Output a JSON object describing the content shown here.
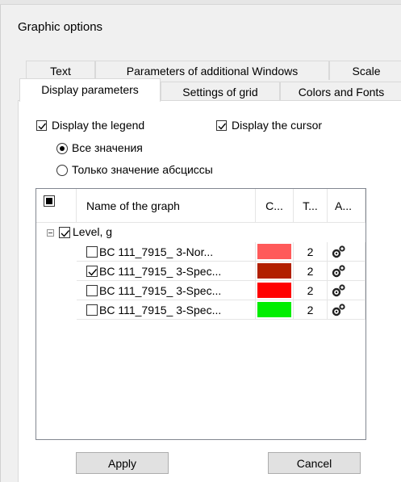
{
  "dialog": {
    "title": "Graphic options"
  },
  "tabs": {
    "text": "Text",
    "additional_windows": "Parameters of additional Windows",
    "scale": "Scale",
    "display_parameters": "Display parameters",
    "grid": "Settings of grid",
    "colors_fonts": "Colors and Fonts",
    "active": "display_parameters"
  },
  "options": {
    "display_legend": {
      "label": "Display the legend",
      "checked": true
    },
    "display_cursor": {
      "label": "Display the cursor",
      "checked": true
    },
    "radio_all": {
      "label": "Все значения",
      "selected": true
    },
    "radio_abscissa": {
      "label": "Только значение абсциссы",
      "selected": false
    }
  },
  "grid": {
    "headers": {
      "name": "Name of the graph",
      "color": "C...",
      "thickness": "T...",
      "action": "A..."
    },
    "group": {
      "label": "Level, g",
      "checked": true,
      "expanded": true
    },
    "rows": [
      {
        "name": "BC 111_7915_ 3-Nor...",
        "checked": false,
        "color": "#ff5a5a",
        "thickness": "2",
        "action_icon": "gears-icon"
      },
      {
        "name": "BC 111_7915_ 3-Spec...",
        "checked": true,
        "color": "#b22000",
        "thickness": "2",
        "action_icon": "gears-icon"
      },
      {
        "name": "BC 111_7915_ 3-Spec...",
        "checked": false,
        "color": "#ff0000",
        "thickness": "2",
        "action_icon": "gears-icon"
      },
      {
        "name": "BC 111_7915_ 3-Spec...",
        "checked": false,
        "color": "#00ee00",
        "thickness": "2",
        "action_icon": "gears-icon"
      }
    ]
  },
  "buttons": {
    "apply": "Apply",
    "cancel": "Cancel"
  }
}
